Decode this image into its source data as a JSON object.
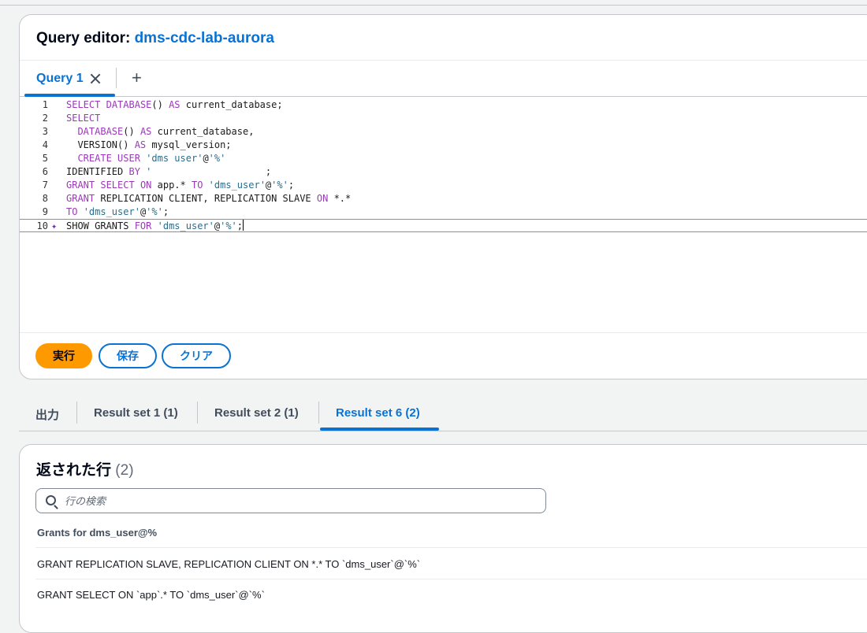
{
  "editor": {
    "title_prefix": "Query editor: ",
    "title_link": "dms-cdc-lab-aurora",
    "tab_label": "Query 1",
    "add_tab": "+",
    "lines": [
      {
        "num": "1",
        "html": "<span class=\"kw\">SELECT</span> <span class=\"kw\">DATABASE</span>() <span class=\"kw\">AS</span> current_database;"
      },
      {
        "num": "2",
        "html": "<span class=\"kw\">SELECT</span>"
      },
      {
        "num": "3",
        "html": "  <span class=\"kw\">DATABASE</span>() <span class=\"kw\">AS</span> current_database,"
      },
      {
        "num": "4",
        "html": "  VERSION() <span class=\"kw\">AS</span> mysql_version;"
      },
      {
        "num": "5",
        "html": "  <span class=\"kw\">CREATE</span> <span class=\"kw\">USER</span> <span class=\"str\">'dms user'</span>@<span class=\"str\">'%'</span>"
      },
      {
        "num": "6",
        "html": "IDENTIFIED <span class=\"kw\">BY</span> <span class=\"str\">'</span>                    ;"
      },
      {
        "num": "7",
        "html": "<span class=\"kw\">GRANT</span> <span class=\"kw\">SELECT</span> <span class=\"kw\">ON</span> app.* <span class=\"kw\">TO</span> <span class=\"str\">'dms_user'</span>@<span class=\"str\">'%'</span>;"
      },
      {
        "num": "8",
        "html": "<span class=\"kw\">GRANT</span> REPLICATION CLIENT, REPLICATION SLAVE <span class=\"kw\">ON</span> *.*"
      },
      {
        "num": "9",
        "html": "<span class=\"kw\">TO</span> <span class=\"str\">'dms_user'</span>@<span class=\"str\">'%'</span>;"
      },
      {
        "num": "10",
        "html": "SHOW GRANTS <span class=\"kw\">FOR</span> <span class=\"str\">'dms_user'</span>@<span class=\"str\">'%'</span>;<span class=\"cursor\"></span>"
      }
    ],
    "buttons": {
      "run": "実行",
      "save": "保存",
      "clear": "クリア"
    }
  },
  "result_tabs": [
    {
      "label": "出力",
      "active": false
    },
    {
      "label": "Result set 1 (1)",
      "active": false
    },
    {
      "label": "Result set 2 (1)",
      "active": false
    },
    {
      "label": "Result set 6 (2)",
      "active": true
    }
  ],
  "rows_panel": {
    "title": "返された行",
    "count": "(2)",
    "search_placeholder": "行の検索",
    "column": "Grants for dms_user@%",
    "rows": [
      "GRANT REPLICATION SLAVE, REPLICATION CLIENT ON *.* TO `dms_user`@`%`",
      "GRANT SELECT ON `app`.* TO `dms_user`@`%`"
    ]
  },
  "colors": {
    "accent": "#0972d3",
    "primary_button": "#ff9900"
  }
}
